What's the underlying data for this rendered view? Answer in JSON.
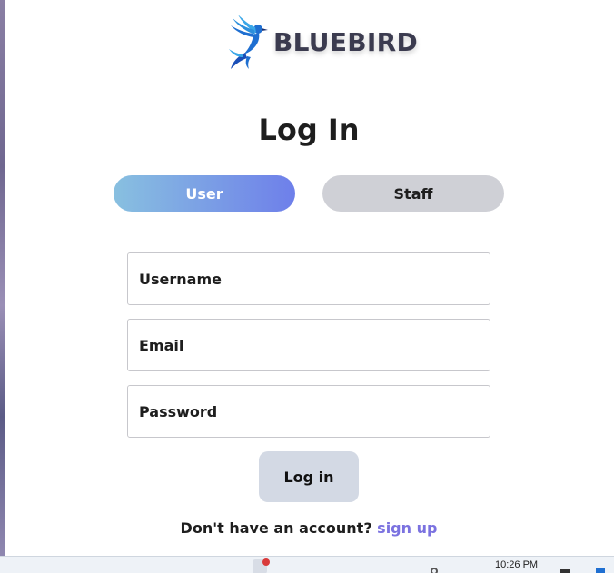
{
  "brand": {
    "name": "BLUEBIRD",
    "logo_icon": "bluebird-logo-icon",
    "colors": {
      "logo_primary": "#1f6fd1",
      "logo_secondary": "#3aa7e8",
      "text": "#3b3b4f"
    }
  },
  "page": {
    "title": "Log In"
  },
  "tabs": {
    "user_label": "User",
    "staff_label": "Staff",
    "active": "User",
    "colors": {
      "active_start": "#88c0e0",
      "active_end": "#6e7fea",
      "inactive": "#cfd0d6"
    }
  },
  "form": {
    "username_placeholder": "Username",
    "email_placeholder": "Email",
    "password_placeholder": "Password",
    "username_value": "",
    "email_value": "",
    "password_value": ""
  },
  "actions": {
    "login_label": "Log in",
    "signup_prompt": "Don't have an account?",
    "signup_link": "sign up",
    "colors": {
      "link": "#7b72e0",
      "login_button": "#d3d9e4"
    }
  },
  "taskbar": {
    "time": "10:26 PM",
    "icons": [
      "app-icon",
      "notification-badge-icon",
      "network-icon",
      "keyboard-icon",
      "widget-icon"
    ]
  }
}
